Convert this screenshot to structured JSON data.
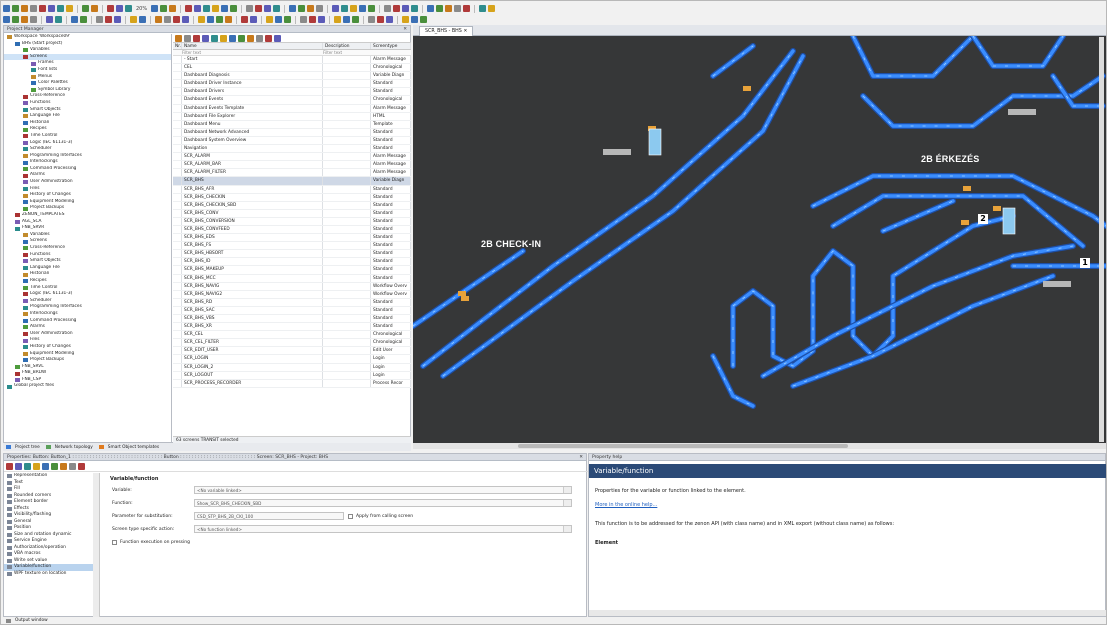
{
  "toolbar": {
    "zoom": "20%"
  },
  "project_manager": {
    "title": "Project Manager",
    "tree": [
      {
        "label": "Workspace 'Workspace09'",
        "d": 0
      },
      {
        "label": "BHS (Start project)",
        "d": 1
      },
      {
        "label": "Variables",
        "d": 2
      },
      {
        "label": "Screens",
        "d": 2,
        "sel": true
      },
      {
        "label": "Frames",
        "d": 3
      },
      {
        "label": "Font lists",
        "d": 3
      },
      {
        "label": "Menus",
        "d": 3
      },
      {
        "label": "Color Palettes",
        "d": 3
      },
      {
        "label": "Symbol Library",
        "d": 3
      },
      {
        "label": "Cross-Reference",
        "d": 2
      },
      {
        "label": "Functions",
        "d": 2
      },
      {
        "label": "Smart Objects",
        "d": 2
      },
      {
        "label": "Language File",
        "d": 2
      },
      {
        "label": "Historian",
        "d": 2
      },
      {
        "label": "Recipes",
        "d": 2
      },
      {
        "label": "Time Control",
        "d": 2
      },
      {
        "label": "Logic (IEC 61131-3)",
        "d": 2
      },
      {
        "label": "Scheduler",
        "d": 2
      },
      {
        "label": "Programming Interfaces",
        "d": 2
      },
      {
        "label": "Interlockings",
        "d": 2
      },
      {
        "label": "Command Processing",
        "d": 2
      },
      {
        "label": "Alarms",
        "d": 2
      },
      {
        "label": "User Administration",
        "d": 2
      },
      {
        "label": "Files",
        "d": 2
      },
      {
        "label": "History of Changes",
        "d": 2
      },
      {
        "label": "Equipment Modeling",
        "d": 2
      },
      {
        "label": "Project Backups",
        "d": 2
      },
      {
        "label": "ZENON_TEMPLATES",
        "d": 1
      },
      {
        "label": "AGL_SCA",
        "d": 1
      },
      {
        "label": "FNB_SRVR",
        "d": 1
      },
      {
        "label": "Variables",
        "d": 2
      },
      {
        "label": "Screens",
        "d": 2
      },
      {
        "label": "Cross-Reference",
        "d": 2
      },
      {
        "label": "Functions",
        "d": 2
      },
      {
        "label": "Smart Objects",
        "d": 2
      },
      {
        "label": "Language File",
        "d": 2
      },
      {
        "label": "Historian",
        "d": 2
      },
      {
        "label": "Recipes",
        "d": 2
      },
      {
        "label": "Time Control",
        "d": 2
      },
      {
        "label": "Logic (IEC 61131-3)",
        "d": 2
      },
      {
        "label": "Scheduler",
        "d": 2
      },
      {
        "label": "Programming Interfaces",
        "d": 2
      },
      {
        "label": "Interlockings",
        "d": 2
      },
      {
        "label": "Command Processing",
        "d": 2
      },
      {
        "label": "Alarms",
        "d": 2
      },
      {
        "label": "User Administration",
        "d": 2
      },
      {
        "label": "Files",
        "d": 2
      },
      {
        "label": "History of Changes",
        "d": 2
      },
      {
        "label": "Equipment Modeling",
        "d": 2
      },
      {
        "label": "Project Backups",
        "d": 2
      },
      {
        "label": "FNB_SRVL",
        "d": 1
      },
      {
        "label": "FNB_BRDW",
        "d": 1
      },
      {
        "label": "FNB_CSP",
        "d": 1
      },
      {
        "label": "Global project files",
        "d": 0
      }
    ],
    "columns": [
      "Nr.",
      "Name",
      "Description",
      "Screentype"
    ],
    "filter_placeholder": "Filter text",
    "rows": [
      {
        "name": "- Start",
        "desc": "",
        "type": "Alarm Message"
      },
      {
        "name": "CEL",
        "desc": "",
        "type": "Chronological"
      },
      {
        "name": "Dashboard Diagnosis",
        "desc": "",
        "type": "Variable Diagn"
      },
      {
        "name": "Dashboard Driver Instance",
        "desc": "",
        "type": "Standard"
      },
      {
        "name": "Dashboard Drivers",
        "desc": "",
        "type": "Standard"
      },
      {
        "name": "Dashboard Events",
        "desc": "",
        "type": "Chronological"
      },
      {
        "name": "Dashboard Events Template",
        "desc": "",
        "type": "Alarm Message"
      },
      {
        "name": "Dashboard File Explorer",
        "desc": "",
        "type": "HTML"
      },
      {
        "name": "Dashboard Menu",
        "desc": "",
        "type": "Template"
      },
      {
        "name": "Dashboard Network Advanced",
        "desc": "",
        "type": "Standard"
      },
      {
        "name": "Dashboard System Overview",
        "desc": "",
        "type": "Standard"
      },
      {
        "name": "Navigation",
        "desc": "",
        "type": "Standard"
      },
      {
        "name": "SCR_ALARM",
        "desc": "",
        "type": "Alarm Message"
      },
      {
        "name": "SCR_ALARM_BAR",
        "desc": "",
        "type": "Alarm Message"
      },
      {
        "name": "SCR_ALARM_FILTER",
        "desc": "",
        "type": "Alarm Message"
      },
      {
        "name": "SCR_BHS",
        "desc": "",
        "type": "Variable Diagn",
        "sel": true
      },
      {
        "name": "SCR_BHS_AFR",
        "desc": "",
        "type": "Standard"
      },
      {
        "name": "SCR_BHS_CHECKIN",
        "desc": "",
        "type": "Standard"
      },
      {
        "name": "SCR_BHS_CHECKIN_SBD",
        "desc": "",
        "type": "Standard"
      },
      {
        "name": "SCR_BHS_CONV",
        "desc": "",
        "type": "Standard"
      },
      {
        "name": "SCR_BHS_CONVERSION",
        "desc": "",
        "type": "Standard"
      },
      {
        "name": "SCR_BHS_CONVFEED",
        "desc": "",
        "type": "Standard"
      },
      {
        "name": "SCR_BHS_EDS",
        "desc": "",
        "type": "Standard"
      },
      {
        "name": "SCR_BHS_FS",
        "desc": "",
        "type": "Standard"
      },
      {
        "name": "SCR_BHS_HBSORT",
        "desc": "",
        "type": "Standard"
      },
      {
        "name": "SCR_BHS_ID",
        "desc": "",
        "type": "Standard"
      },
      {
        "name": "SCR_BHS_MAKEUP",
        "desc": "",
        "type": "Standard"
      },
      {
        "name": "SCR_BHS_MCC",
        "desc": "",
        "type": "Standard"
      },
      {
        "name": "SCR_BHS_NAVIG",
        "desc": "",
        "type": "Workflow Overv"
      },
      {
        "name": "SCR_BHS_NAVIG2",
        "desc": "",
        "type": "Workflow Overv"
      },
      {
        "name": "SCR_BHS_RD",
        "desc": "",
        "type": "Standard"
      },
      {
        "name": "SCR_BHS_SAC",
        "desc": "",
        "type": "Standard"
      },
      {
        "name": "SCR_BHS_VBS",
        "desc": "",
        "type": "Standard"
      },
      {
        "name": "SCR_BHS_XR",
        "desc": "",
        "type": "Standard"
      },
      {
        "name": "SCR_CEL",
        "desc": "",
        "type": "Chronological"
      },
      {
        "name": "SCR_CEL_FILTER",
        "desc": "",
        "type": "Chronological"
      },
      {
        "name": "SCR_EDIT_USER",
        "desc": "",
        "type": "Edit User"
      },
      {
        "name": "SCR_LOGIN",
        "desc": "",
        "type": "Login"
      },
      {
        "name": "SCR_LOGIN_2",
        "desc": "",
        "type": "Login"
      },
      {
        "name": "SCR_LOGOUT",
        "desc": "",
        "type": "Login"
      },
      {
        "name": "SCR_PROCESS_RECORDER",
        "desc": "",
        "type": "Process Recor"
      }
    ],
    "status": "63 screens  TRANSIT selected",
    "tabs": [
      "Project tree",
      "Network topology",
      "Smart Object templates"
    ]
  },
  "canvas": {
    "tab": "SCR_BHS - BHS",
    "labels": {
      "checkin": "2B CHECK-IN",
      "arrival": "2B ÉRKEZÉS"
    },
    "badges": [
      "1",
      "2"
    ]
  },
  "properties": {
    "title": "Properties: Button: Button_1 : : : : : : : : : : : : : : : : : : : : : : : : : : : : : : : Button : : : : : : : : : : : : : : : : : : : : : : : : : : Screen: SCR_BHS - Project: BHS",
    "categories": [
      {
        "label": "Representation"
      },
      {
        "label": "Text"
      },
      {
        "label": "Fill"
      },
      {
        "label": "Rounded corners"
      },
      {
        "label": "Element border"
      },
      {
        "label": "Effects"
      },
      {
        "label": "Visibility/flashing"
      },
      {
        "label": "General"
      },
      {
        "label": "Position"
      },
      {
        "label": "Size and rotation dynamic"
      },
      {
        "label": "Service Engine"
      },
      {
        "label": "Authorization/operation"
      },
      {
        "label": "VBA macros"
      },
      {
        "label": "Write set value"
      },
      {
        "label": "Variable/function",
        "sel": true
      },
      {
        "label": "WPF texture on location"
      }
    ],
    "section": "Variable/function",
    "variable_label": "Variable:",
    "variable_value": "<No variable linked>",
    "function_label": "Function:",
    "function_value": "Show_SCR_BHS_CHECKIN_SBD",
    "param_label": "Parameter for substitution:",
    "param_value": "CSD_STP_BHS_2B_CKI_100",
    "apply_label": "Apply from calling screen",
    "screentype_label": "Screen type specific action:",
    "screentype_value": "<No function linked>",
    "exec_label": "Function execution on pressing"
  },
  "help": {
    "header": "Property help",
    "title": "Variable/function",
    "p1": "Properties for the variable or function linked to the element.",
    "link": "More in the online help...",
    "p2": "This function is to be addressed for the zenon API (with class name) and in XML export (without class name) as follows:",
    "element": "Element"
  },
  "status_bar": {
    "output": "Output window"
  },
  "colors": {
    "pipe": "#3a8dff",
    "pipe_dark": "#1d4fa8",
    "canvas": "#363738",
    "help_header": "#2b4a77"
  }
}
